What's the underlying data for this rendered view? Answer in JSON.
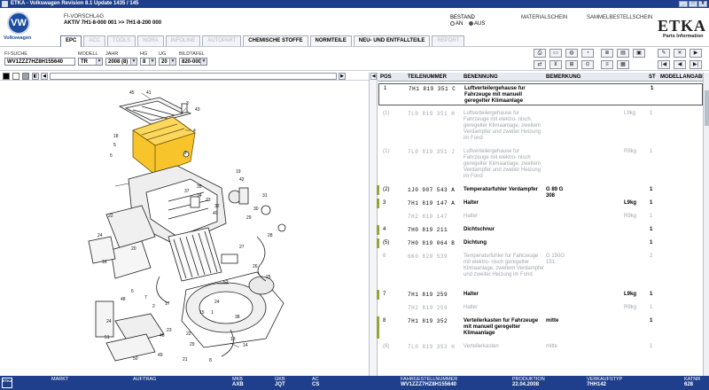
{
  "window": {
    "title": "ETKA - Volkswagen Revision 8.1 Update 1435 / 145",
    "controls": [
      "_",
      "□",
      "X"
    ]
  },
  "header": {
    "brand": "Volkswagen",
    "fi_label": "FI-VORSCHLAG",
    "aktiv_label": "AKTIV",
    "aktiv_value": "7H1-8-000 001 >> 7H1-8-200 000",
    "bestand_label": "BESTAND",
    "bestand_options": [
      "AN",
      "AUS"
    ],
    "bestand_selected": "AUS",
    "materialschein": "MATERIALSCHEIN",
    "sammelbestellschein": "SAMMELBESTELLSCHEIN",
    "etka_logo": "ETKA",
    "etka_sub": "Parts Information"
  },
  "tabs": [
    {
      "label": "EPC",
      "state": "active"
    },
    {
      "label": "ACC",
      "state": "disabled"
    },
    {
      "label": "TOOLS",
      "state": "disabled"
    },
    {
      "label": "NORA",
      "state": "disabled"
    },
    {
      "label": "INFOLINE",
      "state": "disabled"
    },
    {
      "label": "AUTOPART",
      "state": "disabled"
    },
    {
      "label": "CHEMISCHE STOFFE",
      "state": "enabled"
    },
    {
      "label": "NORMTEILE",
      "state": "enabled"
    },
    {
      "label": "NEU- UND ENTFALLTEILE",
      "state": "enabled"
    },
    {
      "label": "REPORT",
      "state": "disabled"
    }
  ],
  "selectors": {
    "fi_suche": {
      "label": "FI-SUCHE",
      "value": "WV1ZZZ7HZ8H155640"
    },
    "modell": {
      "label": "MODELL",
      "value": "TR"
    },
    "jahr": {
      "label": "JAHR",
      "value": "2008 (8)"
    },
    "hg": {
      "label": "HG",
      "value": "8"
    },
    "ug": {
      "label": "UG",
      "value": "20"
    },
    "bildtafel": {
      "label": "BILDTAFEL",
      "value": "820-000"
    }
  },
  "toolbar": {
    "icons": [
      "printer-icon",
      "print-preview-icon",
      "car-front-icon",
      "car-side-icon",
      "document-list-icon",
      "document-detail-icon",
      "note-icon",
      "pin-icon",
      "close-icon",
      "first-page-icon",
      "previous-page-icon",
      "next-page-icon",
      "last-page-icon",
      "swap-icon",
      "filter-icon",
      "grid-icon",
      "view-icon",
      "wheel-icon",
      "stack-icon"
    ]
  },
  "strip": {
    "colors": [
      "#000000",
      "#ffffff",
      "#9aa2b2"
    ]
  },
  "diagram": {
    "callouts": [
      "1",
      "2",
      "3",
      "4",
      "5",
      "6",
      "7",
      "8",
      "13",
      "14",
      "15",
      "16",
      "17",
      "18",
      "19",
      "20",
      "21",
      "22",
      "23",
      "24",
      "25",
      "26",
      "27",
      "28",
      "29",
      "30",
      "31",
      "32",
      "33",
      "34",
      "35",
      "36",
      "37",
      "38",
      "39",
      "40",
      "41",
      "42",
      "43",
      "44",
      "45",
      "46",
      "47",
      "48",
      "49",
      "50",
      "51",
      "52"
    ]
  },
  "parts_table": {
    "columns": [
      "POS",
      "TEILENUMMER",
      "BENENNUNG",
      "BEMERKUNG",
      "ST",
      "MODELLANGABE"
    ],
    "rows": [
      {
        "pos": "1",
        "teil": "7H1  819  351  C",
        "benennung": "Luftverteilergehause fur Fahrzeuge mit manuell geregelter Klimaanlage",
        "bemerkung": "",
        "st": "1",
        "modell": "",
        "dim": false,
        "bar": false,
        "selected": true
      },
      {
        "pos": "(1)",
        "teil": "7L0  819  351  H",
        "benennung": "Luftverteilergehause fur Fahrzeuge mit elektro- nisch geregelter Klimaanlage, zweitem Verdampfer und zweiter Heizung im Fond",
        "bemerkung": "",
        "st": "1",
        "modell": "L9kg",
        "dim": true,
        "bar": false,
        "selected": false
      },
      {
        "pos": "(1)",
        "teil": "7L0  819  351  J",
        "benennung": "Luftverteilergehause fur Fahrzeuge mit elektro- nisch geregelter Klimaanlage, zweitem Verdampfer und zweiter Heizung im Fond",
        "bemerkung": "",
        "st": "1",
        "modell": "R9kg",
        "dim": true,
        "bar": false,
        "selected": false
      },
      {
        "pos": "(2)",
        "teil": "1J0  907  543  A",
        "benennung": "Temperaturfuhler Verdampfer",
        "bemerkung": "G  89 G 308",
        "st": "1",
        "modell": "",
        "dim": false,
        "bar": true,
        "selected": false
      },
      {
        "pos": "3",
        "teil": "7H1  819  147  A",
        "benennung": "Halter",
        "bemerkung": "",
        "st": "1",
        "modell": "L9kg",
        "dim": false,
        "bar": true,
        "selected": false
      },
      {
        "pos": "",
        "teil": "7H2  819  147",
        "benennung": "Halter",
        "bemerkung": "",
        "st": "1",
        "modell": "R9kg",
        "dim": true,
        "bar": false,
        "selected": false
      },
      {
        "pos": "4",
        "teil": "7H0  819  211",
        "benennung": "Dichtschnur",
        "bemerkung": "",
        "st": "1",
        "modell": "",
        "dim": false,
        "bar": true,
        "selected": false
      },
      {
        "pos": "(5)",
        "teil": "7H0  819  064  B",
        "benennung": "Dichtung",
        "bemerkung": "",
        "st": "1",
        "modell": "",
        "dim": false,
        "bar": true,
        "selected": false
      },
      {
        "pos": "6",
        "teil": "6K0  820  539",
        "benennung": "Temperaturfuhler fur Fahrzeuge mit elektro- nisch geregelter Klimaanlage, zweitem Verdampfer und zweiter Heizung im Fond",
        "bemerkung": "G 150G 151",
        "st": "2",
        "modell": "",
        "dim": true,
        "bar": false,
        "selected": false
      },
      {
        "pos": "7",
        "teil": "7H1  819  259",
        "benennung": "Halter",
        "bemerkung": "",
        "st": "1",
        "modell": "L9kg",
        "dim": false,
        "bar": true,
        "selected": false
      },
      {
        "pos": "",
        "teil": "7H2  819  259",
        "benennung": "Halter",
        "bemerkung": "",
        "st": "1",
        "modell": "R9kg",
        "dim": true,
        "bar": false,
        "selected": false
      },
      {
        "pos": "8",
        "teil": "7H1  819  352",
        "benennung": "Verteilerkasten fur Fahrzeuge mit manuell geregelter Klimaanlage",
        "bemerkung": "mitte",
        "st": "1",
        "modell": "",
        "dim": false,
        "bar": true,
        "selected": false
      },
      {
        "pos": "(8)",
        "teil": "7L0  819  352  H",
        "benennung": "Verteilerkasten",
        "bemerkung": "mitte",
        "st": "1",
        "modell": "",
        "dim": true,
        "bar": false,
        "selected": false
      }
    ]
  },
  "statusbar": {
    "markt_label": "MARKT",
    "auftrag_label": "AUFTRAG",
    "mkb_label": "MKB",
    "mkb_value": "AXB",
    "gkb_label": "GKB",
    "gkb_value": "JQT",
    "ac_label": "AC",
    "ac_value": "CS",
    "fgst_label": "FAHRGESTELLNUMMER",
    "fgst_value": "WV1ZZZ7HZ8H155640",
    "prod_label": "PRODUKTION",
    "prod_value": "22.04.2008",
    "vtyp_label": "VERKAUFSTYP",
    "vtyp_value": "7HH142",
    "katnr_label": "KATNR",
    "katnr_value": "628"
  }
}
